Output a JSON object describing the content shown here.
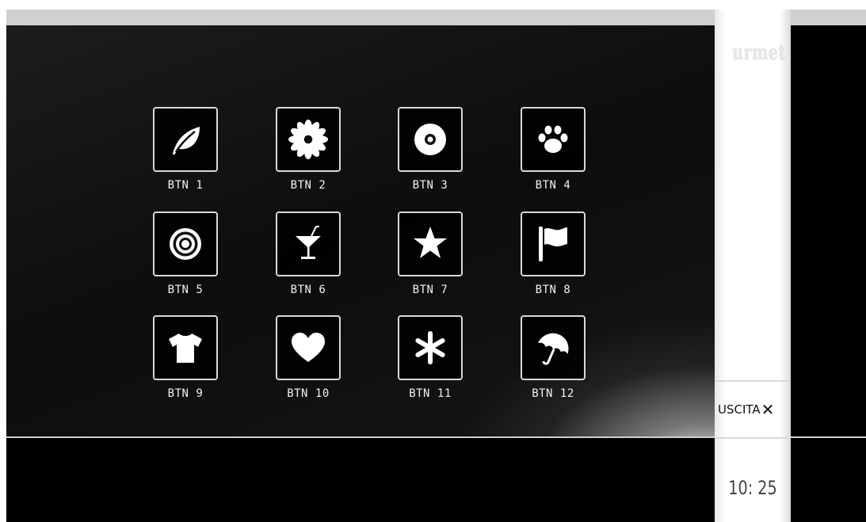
{
  "brand": {
    "logo_text": "urmet"
  },
  "buttons": [
    {
      "label": "BTN 1",
      "icon": "leaf-icon"
    },
    {
      "label": "BTN 2",
      "icon": "flower-icon"
    },
    {
      "label": "BTN 3",
      "icon": "donut-icon"
    },
    {
      "label": "BTN 4",
      "icon": "paw-icon"
    },
    {
      "label": "BTN 5",
      "icon": "target-icon"
    },
    {
      "label": "BTN 6",
      "icon": "cocktail-icon"
    },
    {
      "label": "BTN 7",
      "icon": "star-icon"
    },
    {
      "label": "BTN 8",
      "icon": "flag-icon"
    },
    {
      "label": "BTN 9",
      "icon": "tshirt-icon"
    },
    {
      "label": "BTN 10",
      "icon": "heart-icon"
    },
    {
      "label": "BTN 11",
      "icon": "asterisk-icon"
    },
    {
      "label": "BTN 12",
      "icon": "umbrella-icon"
    }
  ],
  "exit": {
    "label": "USCITA",
    "icon": "close-icon"
  },
  "clock": {
    "time": "10: 25"
  },
  "colors": {
    "panel": "#111111",
    "tile_border": "#d9d9d9",
    "text": "#f0f0f0"
  }
}
